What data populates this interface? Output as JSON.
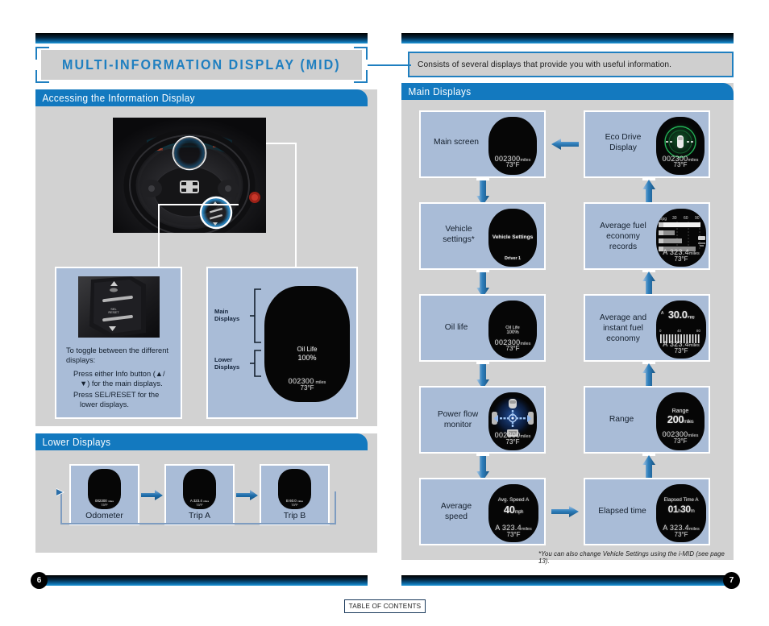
{
  "document": {
    "toc_button": "TABLE OF CONTENTS"
  },
  "left_page": {
    "page_number": "6",
    "title": "MULTI-INFORMATION DISPLAY (MID)",
    "sections": [
      {
        "heading": "Accessing the Information Display"
      },
      {
        "heading": "Lower Displays"
      }
    ],
    "accessing": {
      "instructions_intro": "To toggle between the different displays:",
      "bullets": [
        "Press either Info button (▲/▼) for the main displays.",
        "Press SEL/RESET for the lower displays."
      ],
      "bracket_labels": {
        "main": "Main\nDisplays",
        "main_line1": "Main",
        "main_line2": "Displays",
        "lower_line1": "Lower",
        "lower_line2": "Displays"
      },
      "sample_screen": {
        "title": "Oil Life",
        "value": "100%",
        "odometer": "002300",
        "odometer_unit": "miles",
        "temperature": "73°F"
      }
    },
    "lower_displays": {
      "items": [
        {
          "caption": "Odometer",
          "screen": {
            "odometer": "002300",
            "unit": "miles",
            "temperature": "73°F"
          }
        },
        {
          "caption": "Trip A",
          "screen": {
            "odometer": "A 323.4",
            "unit": "miles",
            "temperature": "73°F"
          }
        },
        {
          "caption": "Trip B",
          "screen": {
            "odometer": "B 60.0",
            "unit": "miles",
            "temperature": "73°F"
          }
        }
      ]
    }
  },
  "right_page": {
    "page_number": "7",
    "callout": "Consists of several displays that provide you with useful information.",
    "section_heading": "Main Displays",
    "footnote": "*You can also change Vehicle Settings using the i-MID (see page 13).",
    "cells": {
      "main_screen": {
        "label": "Main screen",
        "screen": {
          "odometer": "002300",
          "unit": "miles",
          "temperature": "73°F"
        }
      },
      "eco_drive": {
        "label": "Eco Drive\nDisplay",
        "label_line1": "Eco Drive",
        "label_line2": "Display",
        "screen": {
          "odometer": "002300",
          "unit": "miles",
          "temperature": "73°F"
        }
      },
      "vehicle_settings": {
        "label": "Vehicle\nsettings*",
        "label_line1": "Vehicle",
        "label_line2": "settings*",
        "screen": {
          "title": "Vehicle Settings",
          "driver": "Driver 1"
        }
      },
      "fuel_records": {
        "label_line1": "Average fuel",
        "label_line2": "economy",
        "label_line3": "records",
        "screen": {
          "axis_unit": "mpg",
          "ticks": [
            "30",
            "60",
            "90"
          ],
          "bar_labels": [
            "0",
            "1",
            "2",
            "3"
          ],
          "odometer": "A 323.4",
          "unit": "miles",
          "temperature": "73°F"
        }
      },
      "oil_life": {
        "label": "Oil life",
        "screen": {
          "title": "Oil Life",
          "value": "100%",
          "odometer": "002300",
          "unit": "miles",
          "temperature": "73°F"
        }
      },
      "fuel_economy": {
        "label_line1": "Average and",
        "label_line2": "instant fuel",
        "label_line3": "economy",
        "screen": {
          "trip": "A",
          "value": "30.0",
          "unit": "mpg",
          "scale": [
            "0",
            "40",
            "80"
          ],
          "odometer": "A 323.4",
          "odo_unit": "miles",
          "temperature": "73°F"
        }
      },
      "power_flow": {
        "label_line1": "Power flow",
        "label_line2": "monitor",
        "screen": {
          "odometer": "002300",
          "unit": "miles",
          "temperature": "73°F"
        }
      },
      "range": {
        "label": "Range",
        "screen": {
          "title": "Range",
          "value": "200",
          "unit": "miles",
          "odometer": "002300",
          "odo_unit": "miles",
          "temperature": "73°F"
        }
      },
      "average_speed": {
        "label_line1": "Average",
        "label_line2": "speed",
        "screen": {
          "title": "Avg. Speed A",
          "value": "40",
          "unit": "mph",
          "odometer": "A 323.4",
          "odo_unit": "miles",
          "temperature": "73°F"
        }
      },
      "elapsed_time": {
        "label": "Elapsed time",
        "screen": {
          "title": "Elapsed Time A",
          "hours": "01",
          "hours_unit": "h",
          "minutes": "30",
          "minutes_unit": "m",
          "odometer": "A 323.4",
          "odo_unit": "miles",
          "temperature": "73°F"
        }
      }
    }
  },
  "colors": {
    "accent_blue": "#1379bf",
    "title_blue": "#1f7fc0",
    "tile_blue": "#a9bcd7",
    "panel_gray": "#d2d2d2",
    "title_gray": "#cfcfcf",
    "eco_green": "#1ea84e"
  }
}
